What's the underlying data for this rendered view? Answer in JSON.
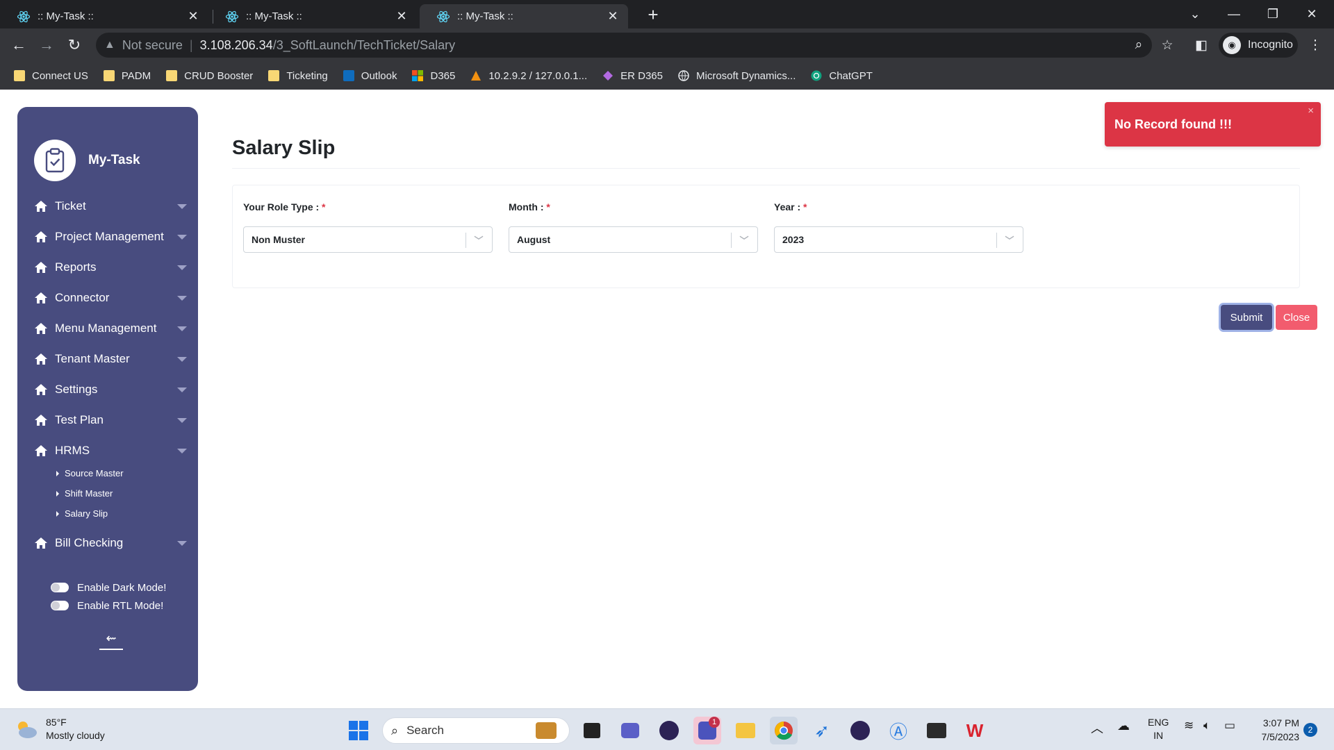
{
  "browser": {
    "tabs": [
      {
        "title": ":: My-Task ::",
        "active": false
      },
      {
        "title": ":: My-Task ::",
        "active": false
      },
      {
        "title": ":: My-Task ::",
        "active": true
      }
    ],
    "address": {
      "security": "Not secure",
      "host": "3.108.206.34",
      "path": "/3_SoftLaunch/TechTicket/Salary"
    },
    "profile": "Incognito",
    "bookmarks": [
      {
        "label": "Connect US",
        "icon": "folder-icon"
      },
      {
        "label": "PADM",
        "icon": "folder-icon"
      },
      {
        "label": "CRUD Booster",
        "icon": "folder-icon"
      },
      {
        "label": "Ticketing",
        "icon": "folder-icon"
      },
      {
        "label": "Outlook",
        "icon": "outlook-icon"
      },
      {
        "label": "D365",
        "icon": "microsoft-icon"
      },
      {
        "label": "10.2.9.2 / 127.0.0.1...",
        "icon": "phpmyadmin-icon"
      },
      {
        "label": "ER D365",
        "icon": "power-apps-icon"
      },
      {
        "label": "Microsoft Dynamics...",
        "icon": "globe-icon"
      },
      {
        "label": "ChatGPT",
        "icon": "chatgpt-icon"
      }
    ]
  },
  "sidebar": {
    "brand": "My-Task",
    "menu": [
      {
        "label": "Ticket"
      },
      {
        "label": "Project Management"
      },
      {
        "label": "Reports"
      },
      {
        "label": "Connector"
      },
      {
        "label": "Menu Management"
      },
      {
        "label": "Tenant Master"
      },
      {
        "label": "Settings"
      },
      {
        "label": "Test Plan"
      },
      {
        "label": "HRMS",
        "children": [
          "Source Master",
          "Shift Master",
          "Salary Slip"
        ]
      },
      {
        "label": "Bill Checking"
      }
    ],
    "toggles": {
      "dark_mode": "Enable Dark Mode!",
      "rtl_mode": "Enable RTL Mode!"
    }
  },
  "main": {
    "title": "Salary Slip",
    "fields": [
      {
        "label": "Your Role Type :",
        "required": "*",
        "value": "Non Muster"
      },
      {
        "label": "Month :",
        "required": "*",
        "value": "August"
      },
      {
        "label": "Year :",
        "required": "*",
        "value": "2023"
      }
    ],
    "buttons": {
      "submit": "Submit",
      "close": "Close"
    }
  },
  "toast": {
    "message": "No Record found !!!",
    "close_glyph": "×",
    "color": "#dc3545"
  },
  "taskbar": {
    "weather": {
      "temp": "85°F",
      "condition": "Mostly cloudy"
    },
    "search_placeholder": "Search",
    "teams_badge": "1",
    "language": {
      "line1": "ENG",
      "line2": "IN"
    },
    "time": "3:07 PM",
    "date": "7/5/2023",
    "notification_count": "2"
  },
  "colors": {
    "sidebar": "#484c7f",
    "submit": "#484c7f",
    "close": "#f25c6e",
    "toast": "#dc3545"
  }
}
